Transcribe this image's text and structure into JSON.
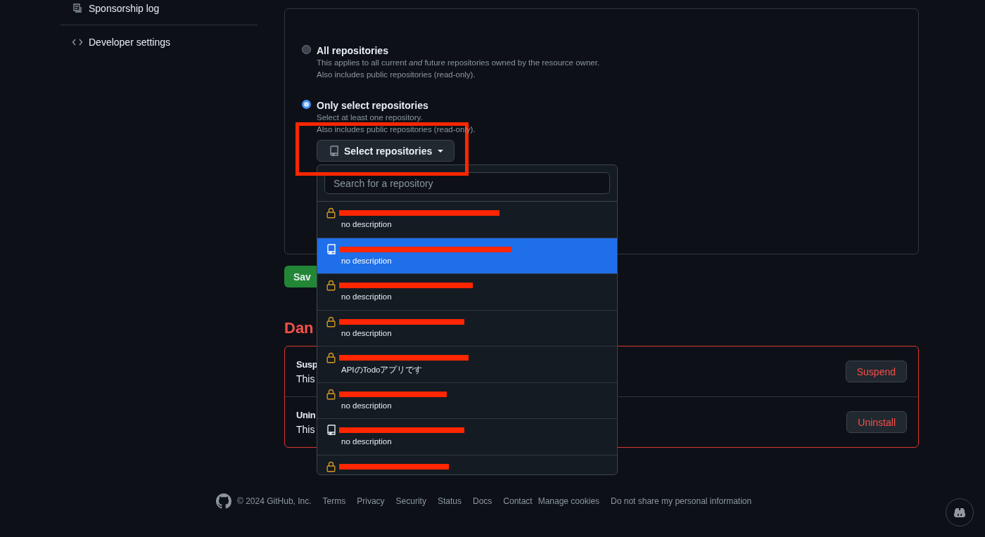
{
  "sidebar": {
    "items": [
      {
        "label": "Sponsorship log"
      },
      {
        "label": "Developer settings"
      }
    ]
  },
  "repository_access": {
    "options": [
      {
        "title": "All repositories",
        "description": "This applies to all current *and* future repositories owned by the resource owner.",
        "note": "Also includes public repositories (read-only).",
        "selected": false
      },
      {
        "title": "Only select repositories",
        "description": "Select at least one repository.",
        "note": "Also includes public repositories (read-only).",
        "selected": true
      }
    ],
    "select_button": {
      "label": "Select repositories"
    },
    "save_button": {
      "label": "Sav"
    }
  },
  "repository_dropdown": {
    "search": {
      "placeholder": "Search for a repository"
    },
    "repositories": [
      {
        "kind": "private",
        "description": "no description",
        "selected": false
      },
      {
        "kind": "public",
        "description": "no description",
        "selected": true
      },
      {
        "kind": "private",
        "description": "no description",
        "selected": false
      },
      {
        "kind": "private",
        "description": "no description",
        "selected": false
      },
      {
        "kind": "private",
        "description": "APIのTodoアプリです",
        "selected": false
      },
      {
        "kind": "private",
        "description": "no description",
        "selected": false
      },
      {
        "kind": "public",
        "description": "no description",
        "selected": false
      },
      {
        "kind": "private",
        "selected": false
      }
    ]
  },
  "danger_zone": {
    "heading": "Dan",
    "items": [
      {
        "title": "Susp",
        "text": "This",
        "button": "Suspend"
      },
      {
        "title": "Unin",
        "text": "This",
        "button": "Uninstall"
      }
    ]
  },
  "footer": {
    "copyright": "© 2024 GitHub, Inc.",
    "links": [
      "Terms",
      "Privacy",
      "Security",
      "Status",
      "Docs",
      "Contact",
      "Manage cookies",
      "Do not share my personal information"
    ]
  }
}
